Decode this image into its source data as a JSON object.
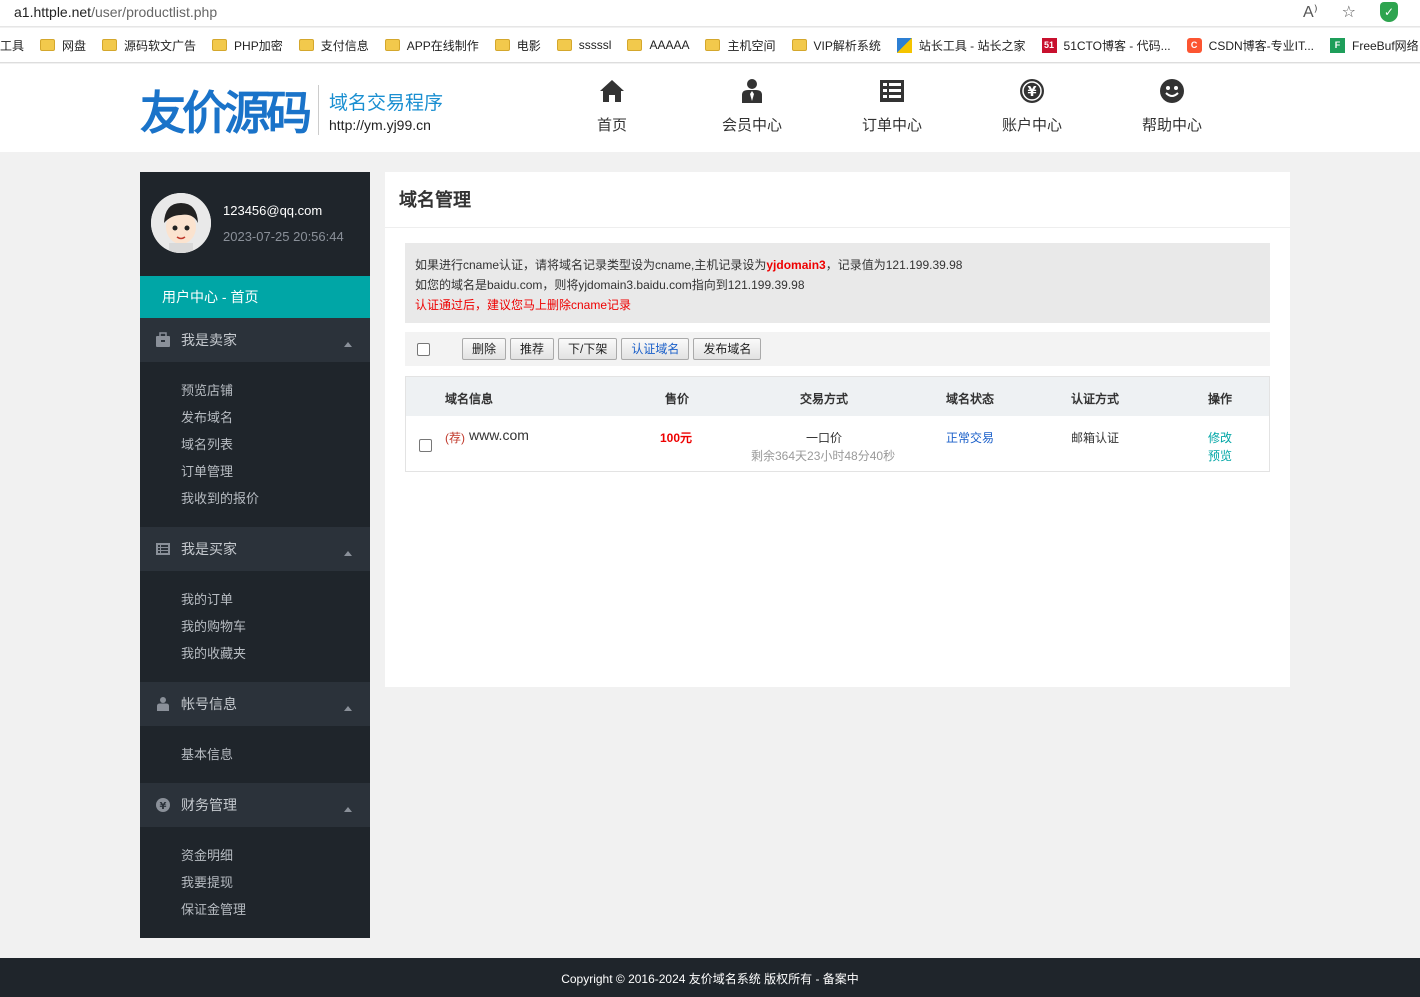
{
  "browser": {
    "url_host": "a1.httple.net",
    "url_path": "/user/productlist.php",
    "bookmarks": [
      {
        "label": "工具",
        "type": "none"
      },
      {
        "label": "网盘",
        "type": "folder"
      },
      {
        "label": "源码软文广告",
        "type": "folder"
      },
      {
        "label": "PHP加密",
        "type": "folder"
      },
      {
        "label": "支付信息",
        "type": "folder"
      },
      {
        "label": "APP在线制作",
        "type": "folder"
      },
      {
        "label": "电影",
        "type": "folder"
      },
      {
        "label": "sssssl",
        "type": "folder"
      },
      {
        "label": "AAAAA",
        "type": "folder"
      },
      {
        "label": "主机空间",
        "type": "folder"
      },
      {
        "label": "VIP解析系统",
        "type": "folder"
      },
      {
        "label": "站长工具 - 站长之家",
        "type": "site"
      },
      {
        "label": "51CTO博客 - 代码...",
        "type": "site"
      },
      {
        "label": "CSDN博客-专业IT...",
        "type": "site"
      },
      {
        "label": "FreeBuf网络",
        "type": "site"
      }
    ]
  },
  "header": {
    "logo_text": "友价源码",
    "logo_title": "域名交易程序",
    "logo_url": "http://ym.yj99.cn",
    "nav": [
      {
        "label": "首页",
        "icon": "home-icon"
      },
      {
        "label": "会员中心",
        "icon": "member-icon"
      },
      {
        "label": "订单中心",
        "icon": "orders-icon"
      },
      {
        "label": "账户中心",
        "icon": "yuan-icon"
      },
      {
        "label": "帮助中心",
        "icon": "smile-icon"
      }
    ]
  },
  "sidebar": {
    "email": "123456@qq.com",
    "time": "2023-07-25 20:56:44",
    "home": "用户中心 - 首页",
    "sections": [
      {
        "title": "我是卖家",
        "icon": "briefcase-icon",
        "items": [
          "预览店铺",
          "发布域名",
          "域名列表",
          "订单管理",
          "我收到的报价"
        ]
      },
      {
        "title": "我是买家",
        "icon": "list-icon",
        "items": [
          "我的订单",
          "我的购物车",
          "我的收藏夹"
        ]
      },
      {
        "title": "帐号信息",
        "icon": "user-icon",
        "items": [
          "基本信息"
        ]
      },
      {
        "title": "财务管理",
        "icon": "yuan-icon",
        "items": [
          "资金明细",
          "我要提现",
          "保证金管理"
        ]
      }
    ]
  },
  "main": {
    "title": "域名管理",
    "notice": {
      "line1_a": "如果进行cname认证，请将域名记录类型设为cname,主机记录设为",
      "line1_highlight": "yjdomain3",
      "line1_b": "，记录值为121.199.39.98",
      "line2": "如您的域名是baidu.com，则将yjdomain3.baidu.com指向到121.199.39.98",
      "line3": "认证通过后，建议您马上删除cname记录"
    },
    "toolbar": [
      "删除",
      "推荐",
      "下/下架",
      "认证域名",
      "发布域名"
    ],
    "columns": [
      "域名信息",
      "售价",
      "交易方式",
      "域名状态",
      "认证方式",
      "操作"
    ],
    "rows": [
      {
        "tag": "(荐)",
        "domain": "www.com",
        "price": "100元",
        "trade": "一口价",
        "remaining": "剩余364天23小时48分40秒",
        "status": "正常交易",
        "verify": "邮箱认证",
        "action_edit": "修改",
        "action_preview": "预览"
      }
    ]
  },
  "footer": "Copyright © 2016-2024 友价域名系统 版权所有 - 备案中",
  "colors": {
    "accent": "#00a6a6",
    "sidebar": "#1f252b",
    "link": "#1a8fd1",
    "price": "#e00000"
  }
}
